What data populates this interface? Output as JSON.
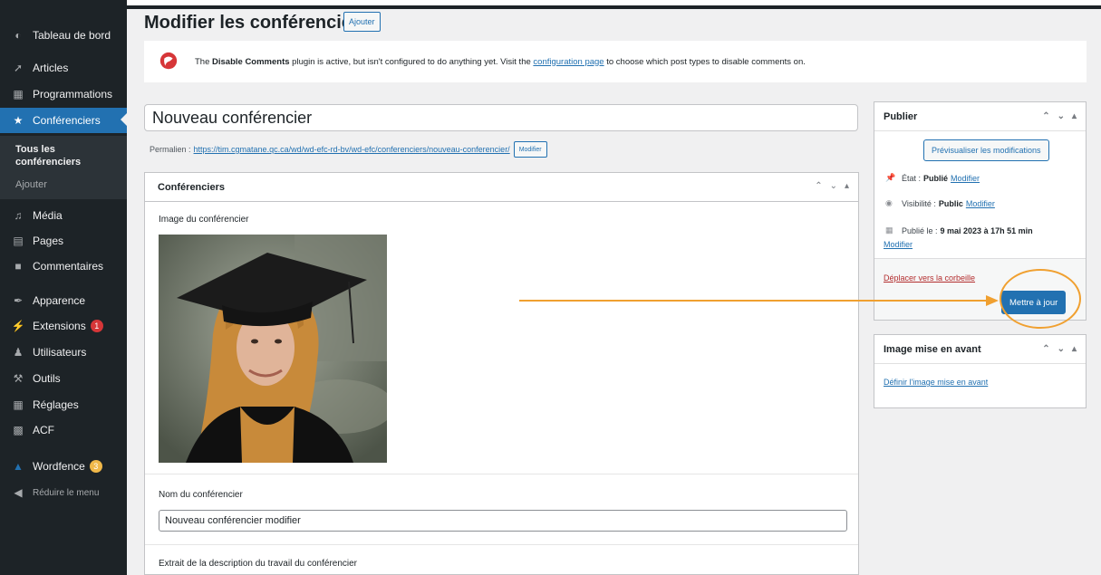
{
  "sidebar": {
    "items": [
      {
        "label": "Tableau de bord",
        "icon": "dashboard-icon"
      },
      {
        "label": "Articles",
        "icon": "pin-icon"
      },
      {
        "label": "Programmations",
        "icon": "calendar-icon"
      },
      {
        "label": "Conférenciers",
        "icon": "star-icon"
      },
      {
        "label": "Média",
        "icon": "media-icon"
      },
      {
        "label": "Pages",
        "icon": "page-icon"
      },
      {
        "label": "Commentaires",
        "icon": "comment-icon"
      },
      {
        "label": "Apparence",
        "icon": "brush-icon"
      },
      {
        "label": "Extensions",
        "icon": "plugin-icon",
        "badge": "1"
      },
      {
        "label": "Utilisateurs",
        "icon": "users-icon"
      },
      {
        "label": "Outils",
        "icon": "wrench-icon"
      },
      {
        "label": "Réglages",
        "icon": "settings-icon"
      },
      {
        "label": "ACF",
        "icon": "grid-icon"
      },
      {
        "label": "Wordfence",
        "icon": "shield-icon",
        "badge": "3"
      }
    ],
    "submenu": {
      "current": "Tous les conférenciers",
      "add": "Ajouter"
    },
    "collapse": "Réduire le menu"
  },
  "header": {
    "title": "Modifier les conférenciers",
    "add_button": "Ajouter"
  },
  "notice": {
    "prefix": "The ",
    "plugin": "Disable Comments",
    "middle": " plugin is active, but isn't configured to do anything yet. Visit the ",
    "link": "configuration page",
    "suffix": " to choose which post types to disable comments on."
  },
  "post": {
    "title": "Nouveau conférencier",
    "permalink_label": "Permalien :",
    "permalink_url": "https://tim.cgmatane.qc.ca/wd/wd-efc-rd-bv/wd-efc/conferenciers/nouveau-conferencier/",
    "permalink_button": "Modifier"
  },
  "metabox": {
    "title": "Conférenciers",
    "image_label": "Image du conférencier",
    "name_label": "Nom du conférencier",
    "name_value": "Nouveau conférencier modifier",
    "excerpt_label": "Extrait de la description du travail du conférencier"
  },
  "publish": {
    "title": "Publier",
    "preview_button": "Prévisualiser les modifications",
    "status_label": "État :",
    "status_value": "Publié",
    "visibility_label": "Visibilité :",
    "visibility_value": "Public",
    "published_label": "Publié le :",
    "published_value": "9 mai 2023 à 17h 51 min",
    "edit_link": "Modifier",
    "trash_link": "Déplacer vers la corbeille",
    "update_button": "Mettre à jour"
  },
  "featured": {
    "title": "Image mise en avant",
    "link": "Définir l'image mise en avant"
  },
  "colors": {
    "accent": "#2271b1",
    "sidebar": "#1d2327",
    "annotation": "#f0a030",
    "danger": "#b32d2e"
  }
}
